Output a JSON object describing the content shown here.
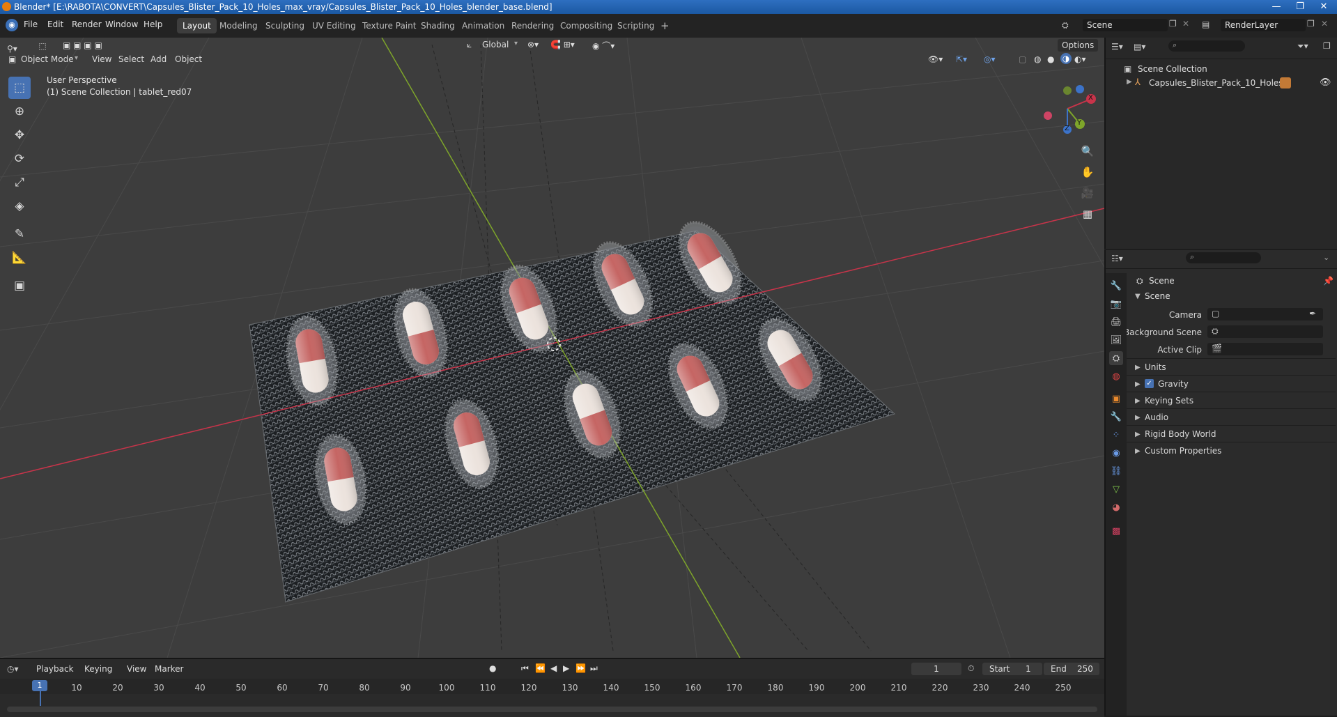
{
  "title_bar": {
    "text": "Blender* [E:\\RABOTA\\CONVERT\\Capsules_Blister_Pack_10_Holes_max_vray/Capsules_Blister_Pack_10_Holes_blender_base.blend]",
    "minimize": "—",
    "maximize": "❐",
    "close": "✕"
  },
  "menu": [
    "File",
    "Edit",
    "Render",
    "Window",
    "Help"
  ],
  "workspaces": [
    "Layout",
    "Modeling",
    "Sculpting",
    "UV Editing",
    "Texture Paint",
    "Shading",
    "Animation",
    "Rendering",
    "Compositing",
    "Scripting",
    "+"
  ],
  "active_workspace": "Layout",
  "scene_field": "Scene",
  "renderlayer_field": "RenderLayer",
  "transform": {
    "orientation": "Global",
    "options_label": "Options"
  },
  "viewport_header": {
    "mode": "Object Mode",
    "menus": [
      "View",
      "Select",
      "Add",
      "Object"
    ]
  },
  "viewport": {
    "perspective_label": "User Perspective",
    "collection_label": "(1) Scene Collection | tablet_red07",
    "gizmo_axes": {
      "x": "X",
      "y": "Y",
      "z": "Z"
    }
  },
  "outliner": {
    "root": "Scene Collection",
    "item": "Capsules_Blister_Pack_10_Holes"
  },
  "properties": {
    "context": "Scene",
    "section": "Scene",
    "camera_label": "Camera",
    "background_scene_label": "Background Scene",
    "active_clip_label": "Active Clip",
    "panels": [
      "Units",
      "Gravity",
      "Keying Sets",
      "Audio",
      "Rigid Body World",
      "Custom Properties"
    ],
    "gravity_checked": true
  },
  "timeline": {
    "menus": [
      "Playback",
      "Keying",
      "View",
      "Marker"
    ],
    "current_frame": "1",
    "start_label": "Start",
    "start": "1",
    "end_label": "End",
    "end": "250",
    "ticks": [
      "1",
      "10",
      "20",
      "30",
      "40",
      "50",
      "60",
      "70",
      "80",
      "90",
      "100",
      "110",
      "120",
      "130",
      "140",
      "150",
      "160",
      "170",
      "180",
      "190",
      "200",
      "210",
      "220",
      "230",
      "240",
      "250"
    ]
  },
  "colors": {
    "accent": "#4772b3",
    "x_axis": "#c8344a",
    "y_axis": "#7ea52a",
    "viewport_bg": "#3d3d3d",
    "capsule_red": "#c56563",
    "capsule_white": "#ece3dd"
  }
}
